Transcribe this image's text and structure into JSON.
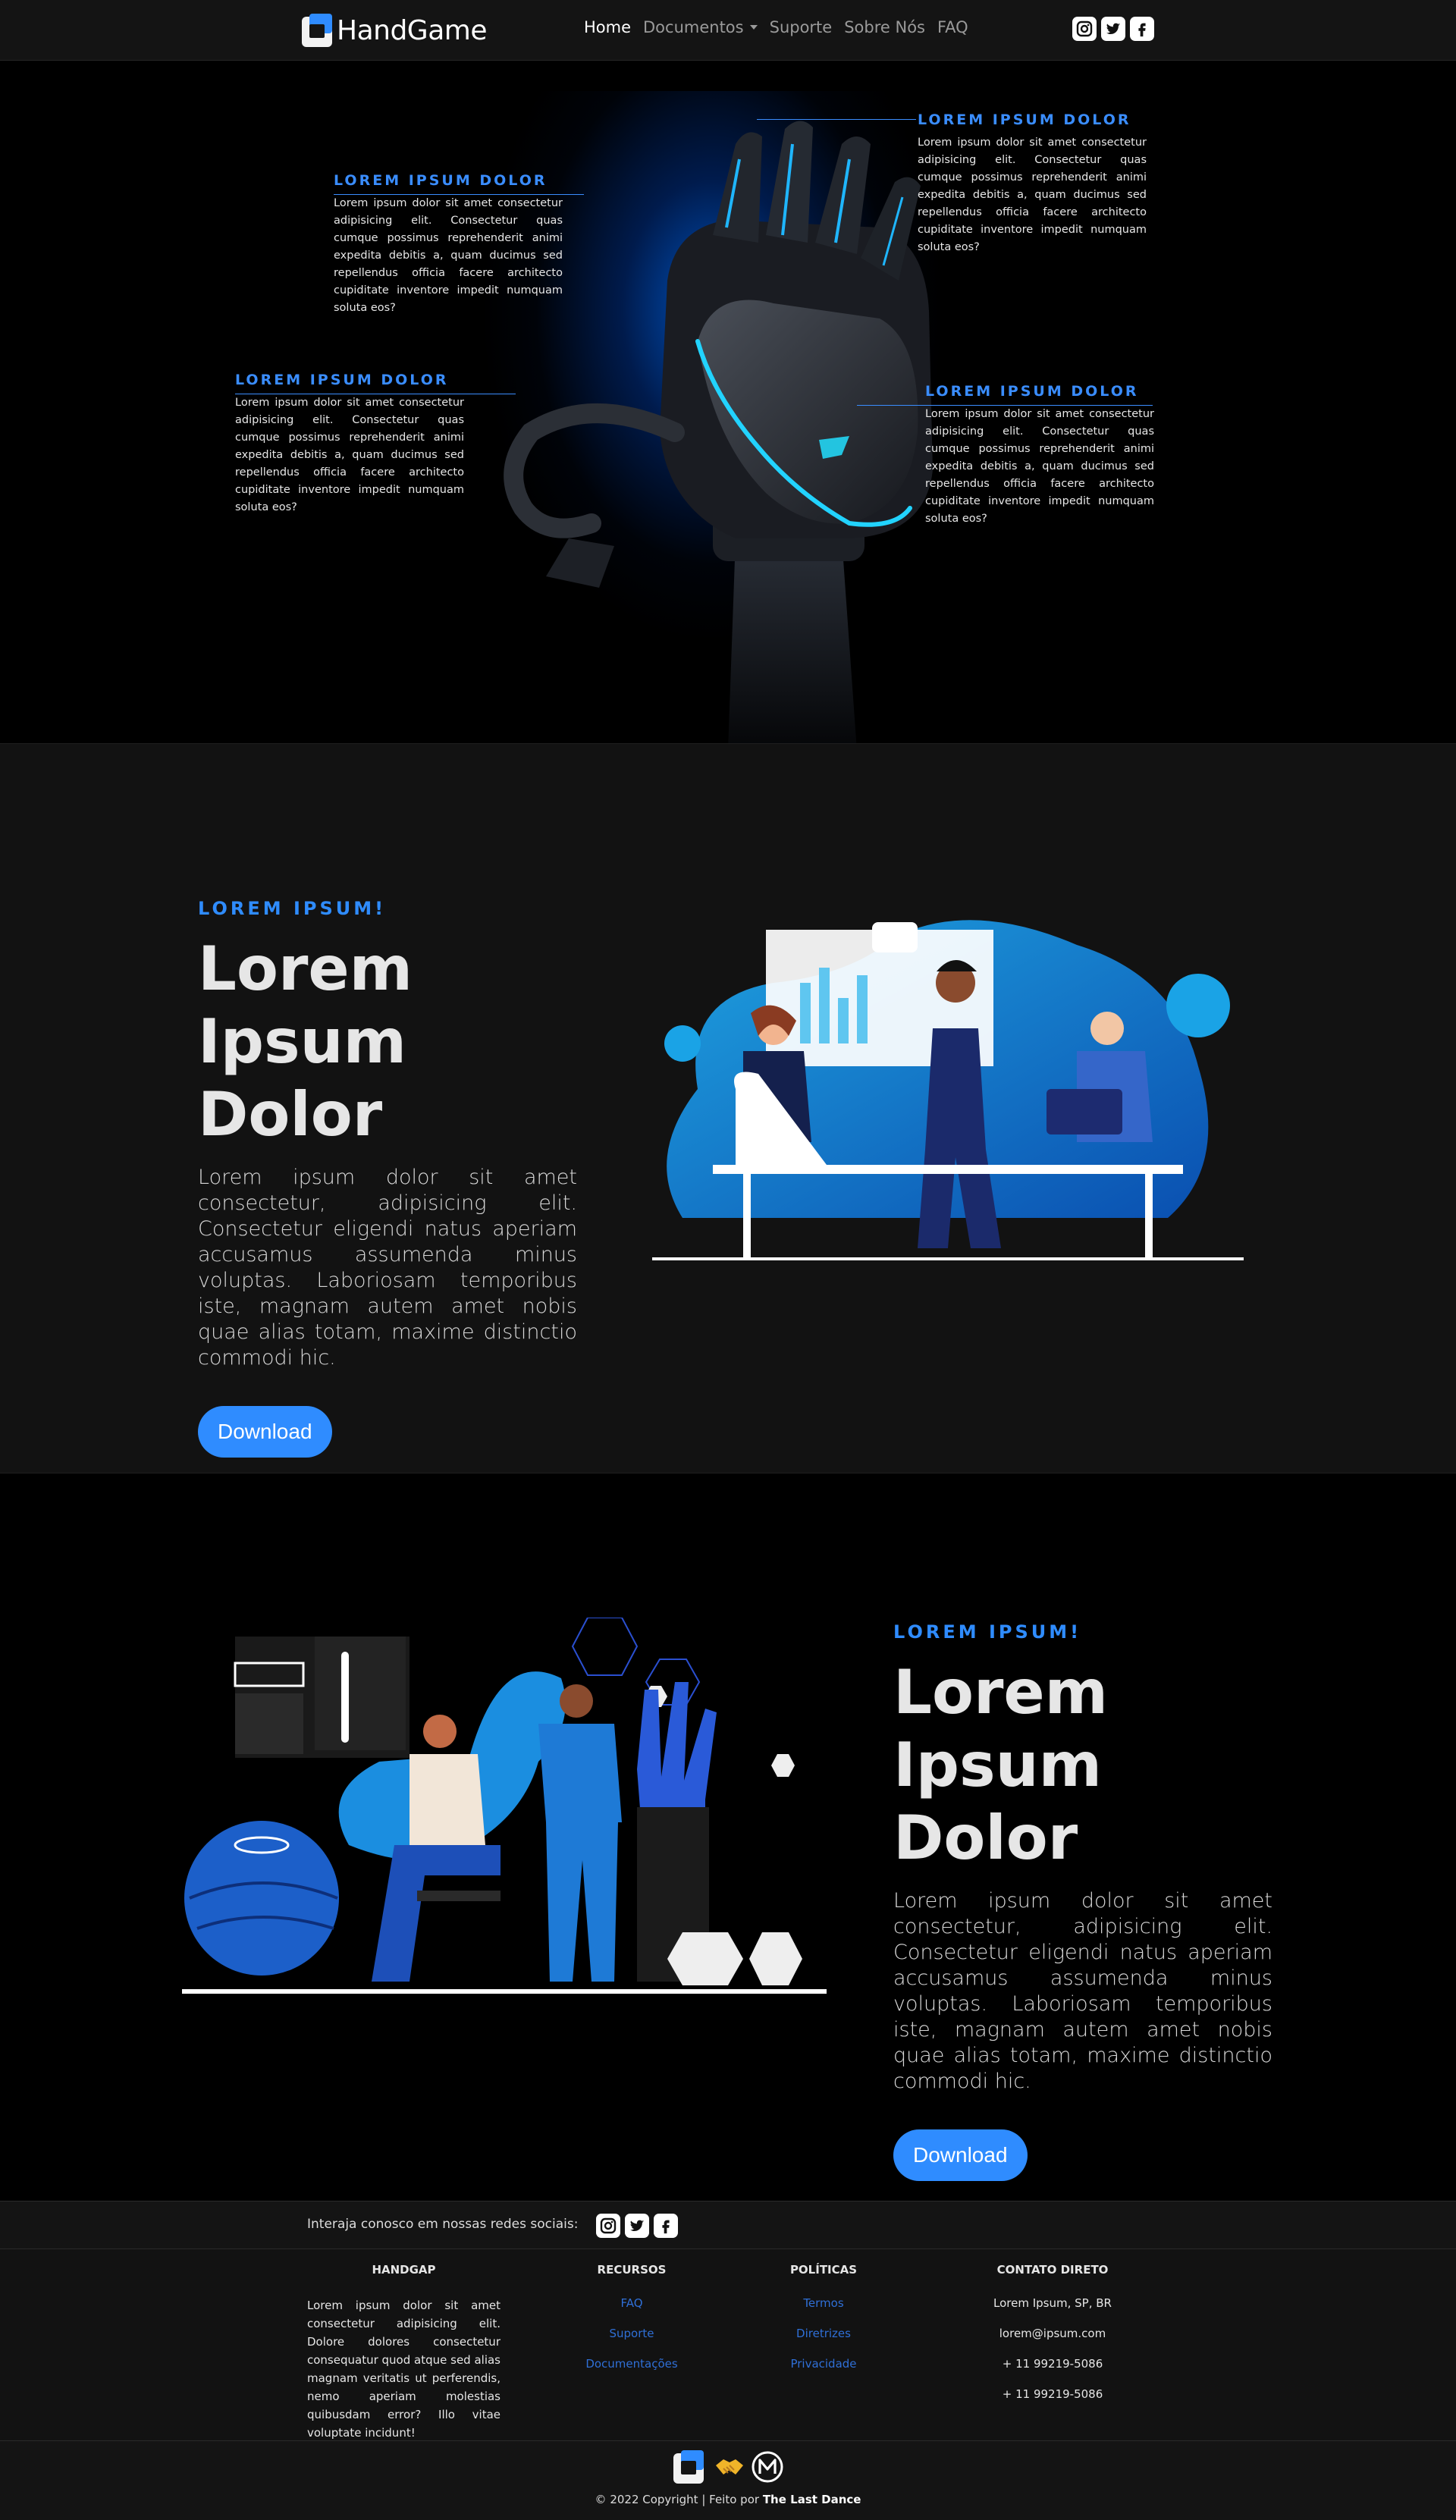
{
  "nav": {
    "brand": "HandGame",
    "links": [
      {
        "label": "Home",
        "active": true
      },
      {
        "label": "Documentos",
        "dropdown": true
      },
      {
        "label": "Suporte"
      },
      {
        "label": "Sobre Nós"
      },
      {
        "label": "FAQ"
      }
    ],
    "social_icons": [
      "instagram-icon",
      "twitter-icon",
      "facebook-icon"
    ]
  },
  "hero": {
    "callouts": [
      {
        "title": "LOREM IPSUM DOLOR",
        "text": "Lorem ipsum dolor sit amet consectetur adipisicing elit. Consectetur quas cumque possimus reprehenderit animi expedita debitis a, quam ducimus sed repellendus officia facere architecto cupiditate inventore impedit numquam soluta eos?"
      },
      {
        "title": "LOREM IPSUM DOLOR",
        "text": "Lorem ipsum dolor sit amet consectetur adipisicing elit. Consectetur quas cumque possimus reprehenderit animi expedita debitis a, quam ducimus sed repellendus officia facere architecto cupiditate inventore impedit numquam soluta eos?"
      },
      {
        "title": "LOREM IPSUM DOLOR",
        "text": "Lorem ipsum dolor sit amet consectetur adipisicing elit. Consectetur quas cumque possimus reprehenderit animi expedita debitis a, quam ducimus sed repellendus officia facere architecto cupiditate inventore impedit numquam soluta eos?"
      },
      {
        "title": "LOREM IPSUM DOLOR",
        "text": "Lorem ipsum dolor sit amet consectetur adipisicing elit. Consectetur quas cumque possimus reprehenderit animi expedita debitis a, quam ducimus sed repellendus officia facere architecto cupiditate inventore impedit numquam soluta eos?"
      }
    ]
  },
  "section1": {
    "eyebrow": "LOREM IPSUM!",
    "heading": "Lorem Ipsum Dolor",
    "text": "Lorem ipsum dolor sit amet consectetur, adipisicing elit. Consectetur eligendi natus aperiam accusamus assumenda minus voluptas. Laboriosam temporibus iste, magnam autem amet nobis quae alias totam, maxime distinctio commodi hic.",
    "button": "Download"
  },
  "section2": {
    "eyebrow": "LOREM IPSUM!",
    "heading": "Lorem Ipsum Dolor",
    "text": "Lorem ipsum dolor sit amet consectetur, adipisicing elit. Consectetur eligendi natus aperiam accusamus assumenda minus voluptas. Laboriosam temporibus iste, magnam autem amet nobis quae alias totam, maxime distinctio commodi hic.",
    "button": "Download"
  },
  "social_strip": {
    "text": "Interaja conosco em nossas redes sociais:"
  },
  "footer": {
    "about": {
      "title": "HANDGAP",
      "text": "Lorem ipsum dolor sit amet consectetur adipisicing elit. Dolore dolores consectetur consequatur quod atque sed alias magnam veritatis ut perferendis, nemo aperiam molestias quibusdam error? Illo vitae voluptate incidunt!"
    },
    "resources": {
      "title": "RECURSOS",
      "links": [
        "FAQ",
        "Suporte",
        "Documentações"
      ]
    },
    "policies": {
      "title": "POLÍTICAS",
      "links": [
        "Termos",
        "Diretrizes",
        "Privacidade"
      ]
    },
    "contact": {
      "title": "CONTATO DIRETO",
      "items": [
        "Lorem Ipsum, SP, BR",
        "lorem@ipsum.com",
        "+ 11 99219-5086",
        "+ 11 99219-5086"
      ]
    }
  },
  "credits": {
    "prefix": "© 2022 Copyright | Feito por",
    "author": "The Last Dance"
  },
  "colors": {
    "accent": "#2f8cff",
    "background": "#000000",
    "section_alt": "#121212"
  }
}
